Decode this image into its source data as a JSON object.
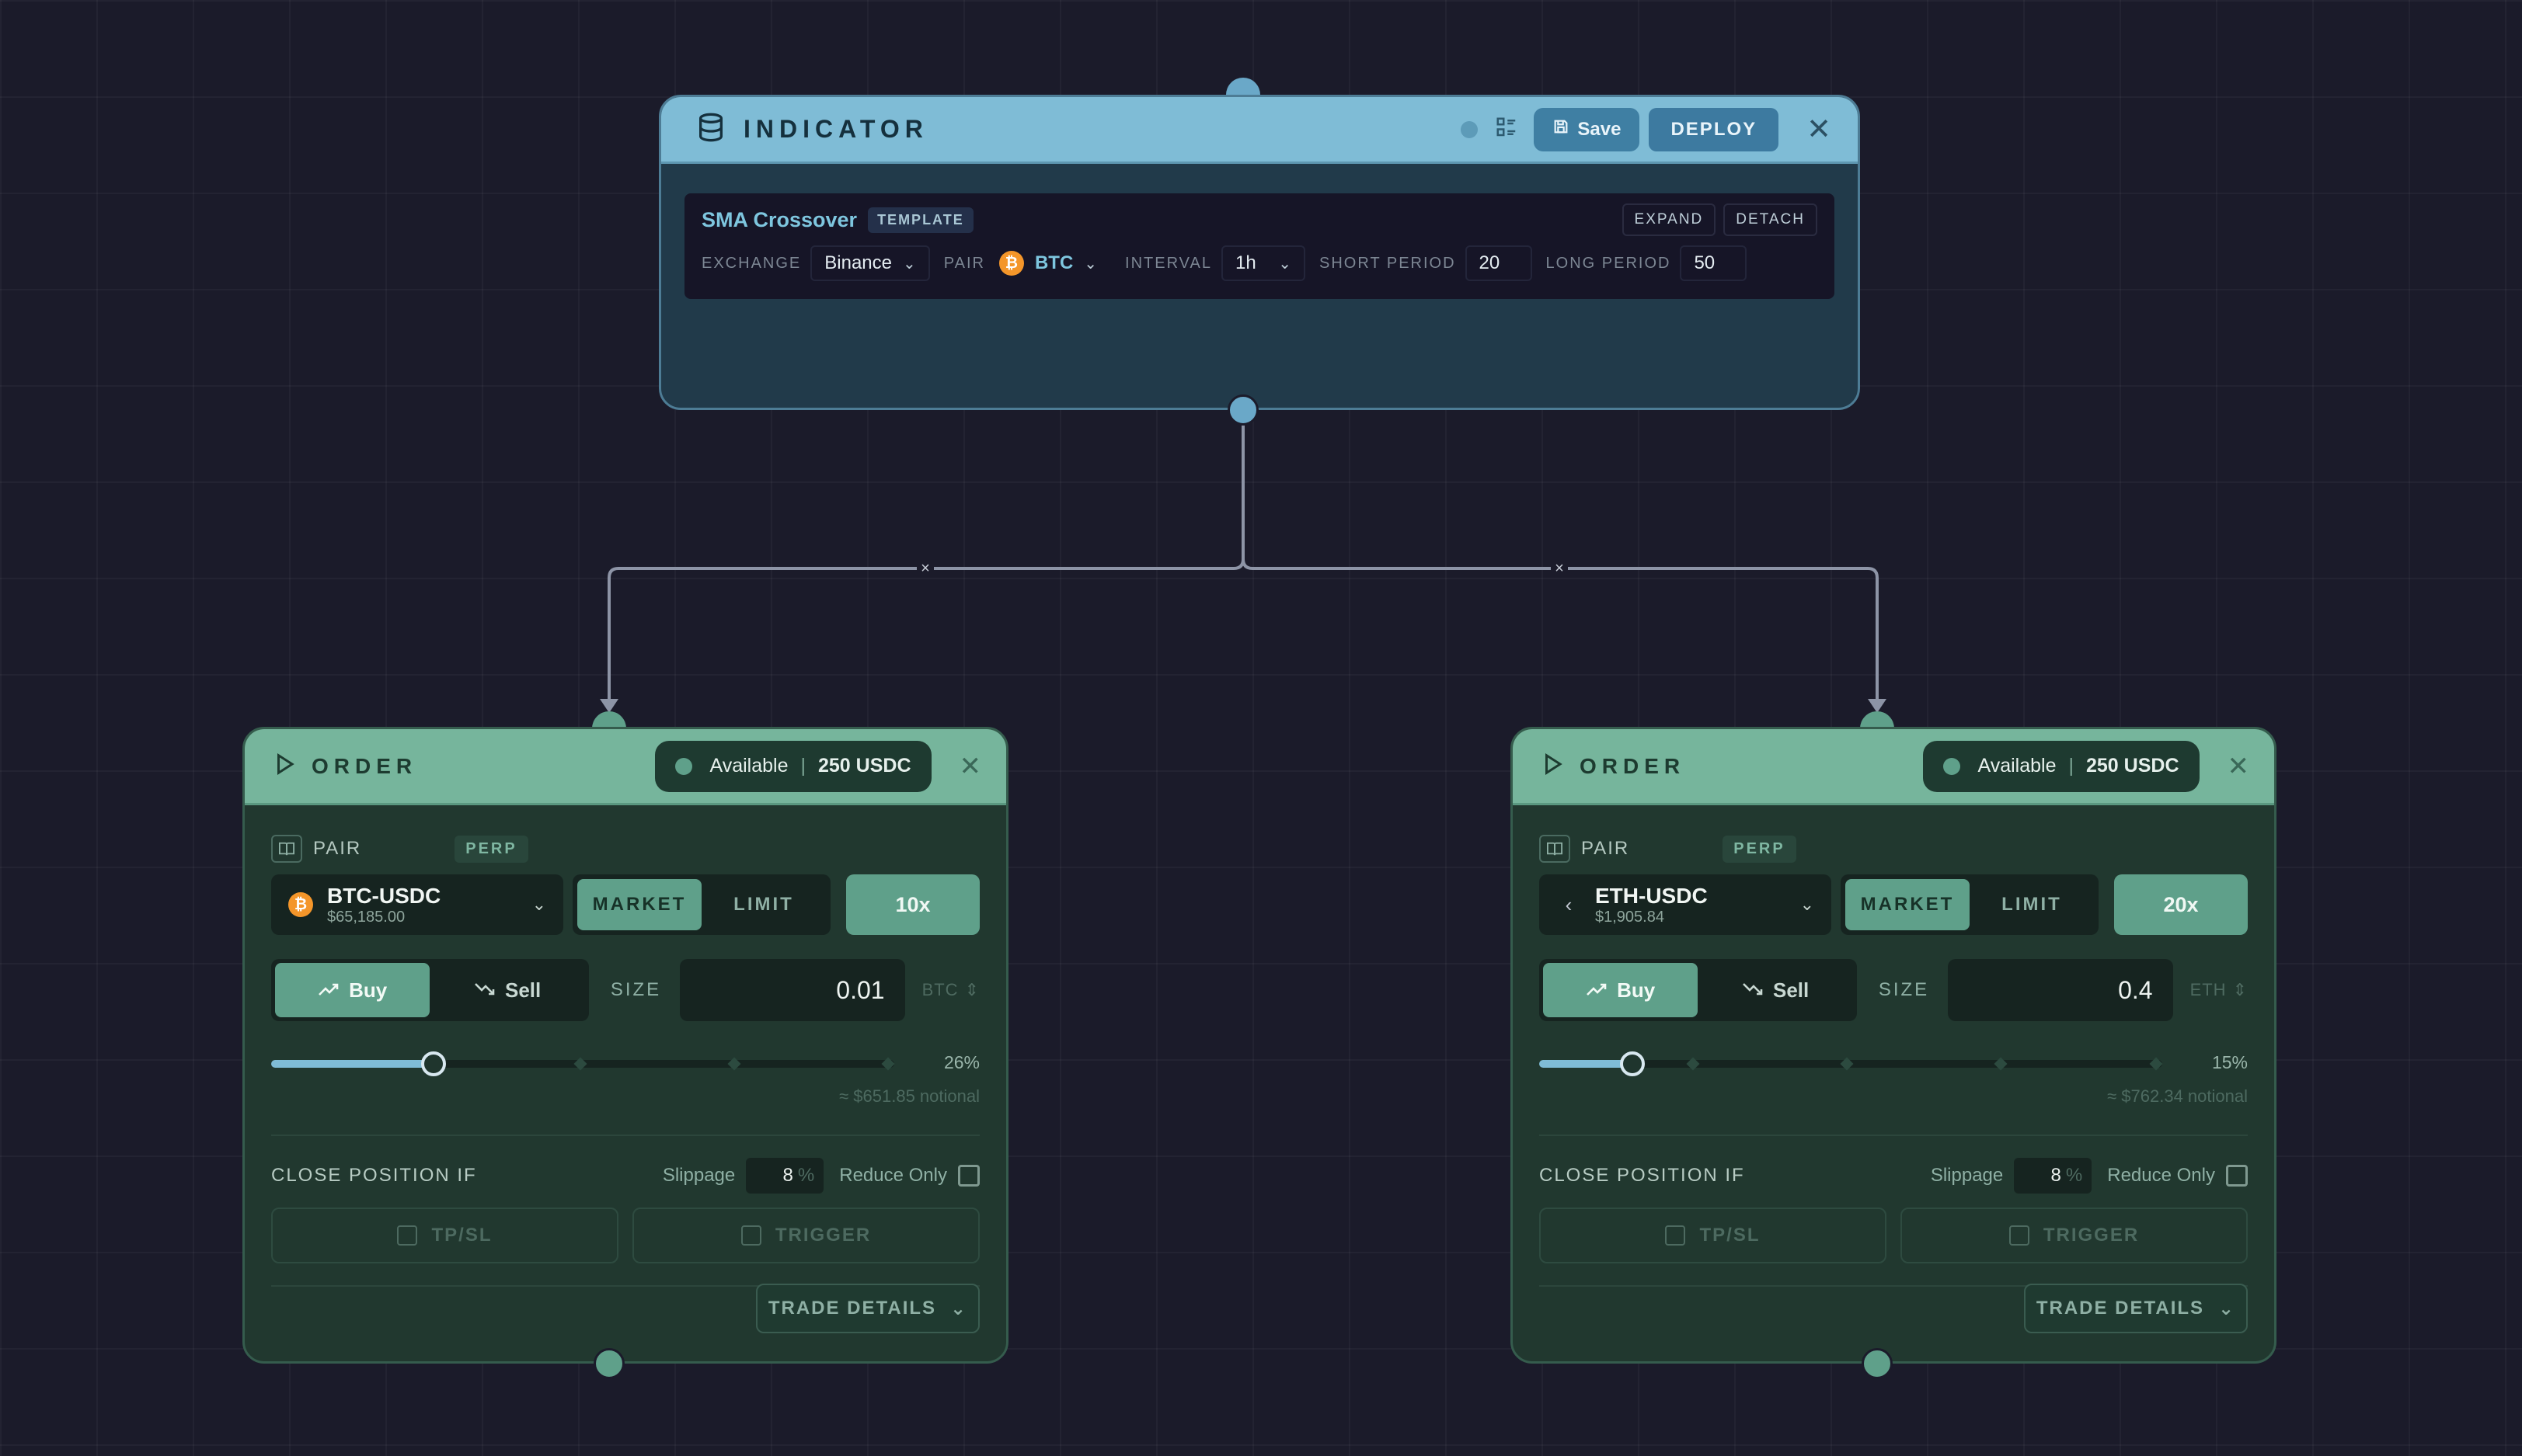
{
  "indicator": {
    "title": "INDICATOR",
    "save_label": "Save",
    "deploy_label": "DEPLOY",
    "close_symbol": "✕",
    "strategy_name": "SMA Crossover",
    "template_tag": "TEMPLATE",
    "expand_label": "EXPAND",
    "detach_label": "DETACH",
    "exchange_label": "EXCHANGE",
    "exchange_value": "Binance",
    "pair_label": "PAIR",
    "pair_value": "BTC",
    "interval_label": "INTERVAL",
    "interval_value": "1h",
    "short_period_label": "SHORT PERIOD",
    "short_period_value": "20",
    "long_period_label": "LONG PERIOD",
    "long_period_value": "50",
    "colors": {
      "header": "#7fbcd6",
      "body": "#213a4a"
    }
  },
  "orders": [
    {
      "title": "ORDER",
      "available_label": "Available",
      "available_amount": "250 USDC",
      "pair_label": "PAIR",
      "perp_tag": "PERP",
      "pair_symbol": "BTC-USDC",
      "pair_price": "$65,185.00",
      "coin_icon": "bitcoin-icon",
      "order_type_options": [
        "MARKET",
        "LIMIT"
      ],
      "order_type_selected": "MARKET",
      "leverage": "10x",
      "side_options": [
        "Buy",
        "Sell"
      ],
      "side_selected": "Buy",
      "size_label": "SIZE",
      "size_value": "0.01",
      "size_unit": "BTC",
      "slider_percent_label": "26%",
      "slider_fraction": 0.26,
      "notional": "≈ $651.85 notional",
      "close_position_label": "CLOSE POSITION IF",
      "slippage_label": "Slippage",
      "slippage_value": "8",
      "slippage_unit": "%",
      "reduce_only_label": "Reduce Only",
      "tpsl_label": "TP/SL",
      "trigger_label": "TRIGGER",
      "trade_details_label": "TRADE DETAILS"
    },
    {
      "title": "ORDER",
      "available_label": "Available",
      "available_amount": "250 USDC",
      "pair_label": "PAIR",
      "perp_tag": "PERP",
      "pair_symbol": "ETH-USDC",
      "pair_price": "$1,905.84",
      "coin_icon": "ethereum-icon",
      "order_type_options": [
        "MARKET",
        "LIMIT"
      ],
      "order_type_selected": "MARKET",
      "leverage": "20x",
      "side_options": [
        "Buy",
        "Sell"
      ],
      "side_selected": "Buy",
      "size_label": "SIZE",
      "size_value": "0.4",
      "size_unit": "ETH",
      "slider_percent_label": "15%",
      "slider_fraction": 0.15,
      "notional": "≈ $762.34 notional",
      "close_position_label": "CLOSE POSITION IF",
      "slippage_label": "Slippage",
      "slippage_value": "8",
      "slippage_unit": "%",
      "reduce_only_label": "Reduce Only",
      "tpsl_label": "TP/SL",
      "trigger_label": "TRIGGER",
      "trade_details_label": "TRADE DETAILS"
    }
  ],
  "edge_delete_symbol": "×",
  "colors": {
    "canvas": "#1b1b2a",
    "order_header": "#76b59c",
    "order_body": "#21382f",
    "accent": "#5fa08a"
  }
}
